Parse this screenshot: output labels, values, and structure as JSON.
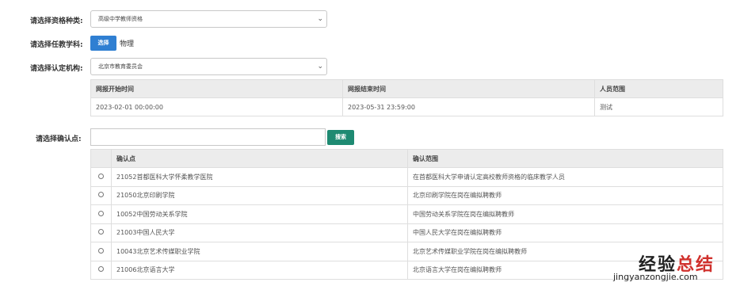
{
  "form": {
    "qualification_label": "请选择资格种类:",
    "qualification_value": "高级中学教师资格",
    "subject_label": "请选择任教学科:",
    "subject_button": "选择",
    "subject_value": "物理",
    "authority_label": "请选择认定机构:",
    "authority_value": "北京市教育委员会"
  },
  "period_table": {
    "headers": [
      "网报开始时间",
      "网报结束时间",
      "人员范围"
    ],
    "row": [
      "2023-02-01 00:00:00",
      "2023-05-31 23:59:00",
      "测试"
    ]
  },
  "confirm": {
    "label": "请选择确认点:",
    "search_value": "",
    "search_button": "搜索",
    "headers": [
      "",
      "确认点",
      "确认范围"
    ],
    "rows": [
      {
        "point": "21052首都医科大学怀柔教学医院",
        "scope": "在首都医科大学申请认定高校教师资格的临床教学人员"
      },
      {
        "point": "21050北京印刷学院",
        "scope": "北京印刷学院在岗在编拟聘教师"
      },
      {
        "point": "10052中国劳动关系学院",
        "scope": "中国劳动关系学院在岗在编拟聘教师"
      },
      {
        "point": "21003中国人民大学",
        "scope": "中国人民大学在岗在编拟聘教师"
      },
      {
        "point": "10043北京艺术传媒职业学院",
        "scope": "北京艺术传媒职业学院在岗在编拟聘教师"
      },
      {
        "point": "21006北京语言大学",
        "scope": "北京语言大学在岗在编拟聘教师"
      }
    ]
  },
  "watermark": {
    "line1_a": "经验",
    "line1_b": "总结",
    "line2": "jingyanzongjie.com",
    "color_a": "#222222",
    "color_b": "#d0312d"
  }
}
